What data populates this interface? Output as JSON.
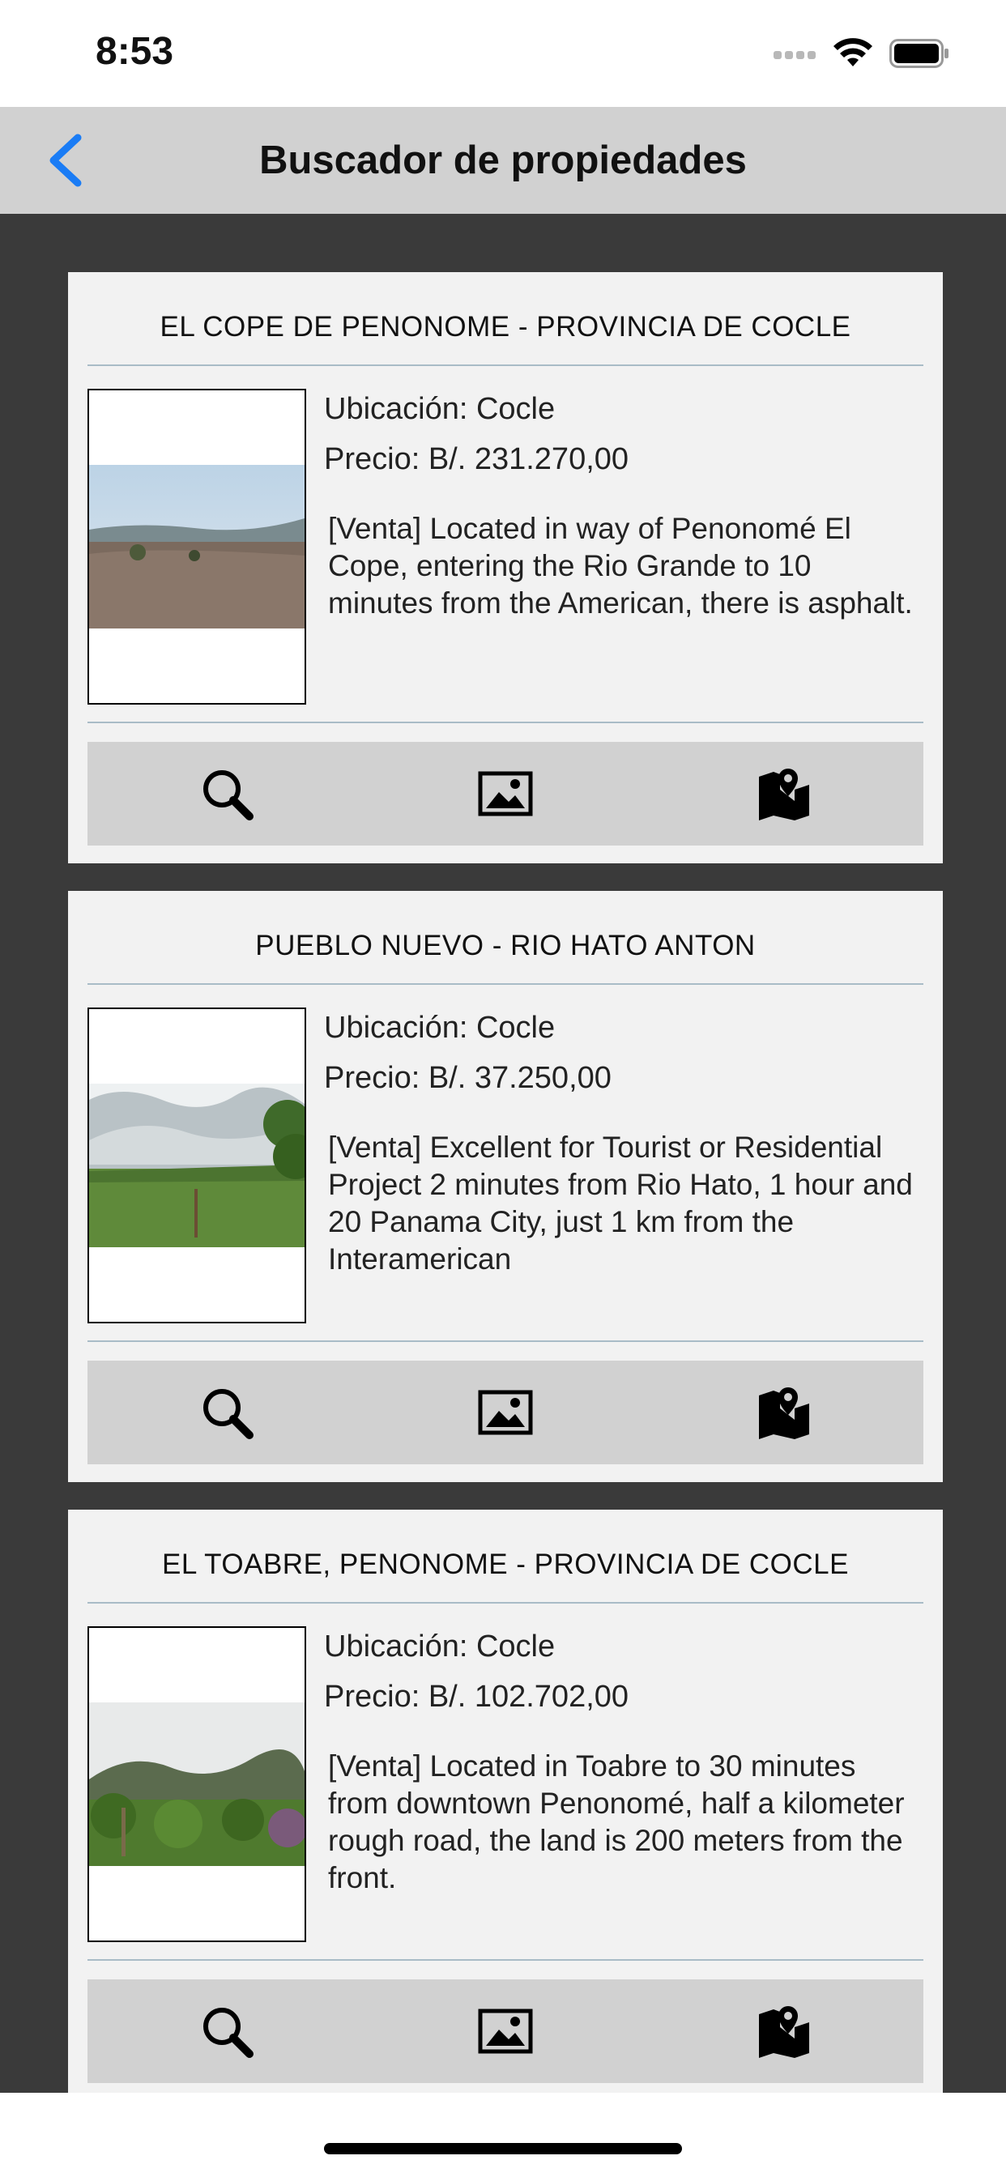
{
  "status_bar": {
    "time": "8:53"
  },
  "nav": {
    "title": "Buscador de propiedades"
  },
  "listings": [
    {
      "title": "EL COPE DE PENONOME - PROVINCIA DE COCLE",
      "location": "Ubicación: Cocle",
      "price": "Precio: B/. 231.270,00",
      "description": "[Venta] Located in way of Penonomé El Cope, entering the Rio Grande to 10 minutes from the American, there is asphalt."
    },
    {
      "title": "PUEBLO NUEVO - RIO HATO ANTON",
      "location": "Ubicación: Cocle",
      "price": "Precio: B/. 37.250,00",
      "description": "[Venta] Excellent for Tourist or Residential Project 2 minutes from Rio Hato, 1 hour and 20 Panama City, just 1 km from the Interamerican"
    },
    {
      "title": "EL TOABRE, PENONOME - PROVINCIA DE COCLE",
      "location": "Ubicación: Cocle",
      "price": "Precio: B/. 102.702,00",
      "description": "[Venta] Located in Toabre to 30 minutes from downtown Penonomé, half a kilometer rough road, the land is 200 meters from the front."
    }
  ],
  "actions": [
    "magnifier-icon",
    "image-icon",
    "map-pin-icon"
  ],
  "colors": {
    "accent": "#1a7cf5",
    "background": "#3a3a3a",
    "card": "#f2f2f2",
    "bar": "#d1d1d1"
  }
}
